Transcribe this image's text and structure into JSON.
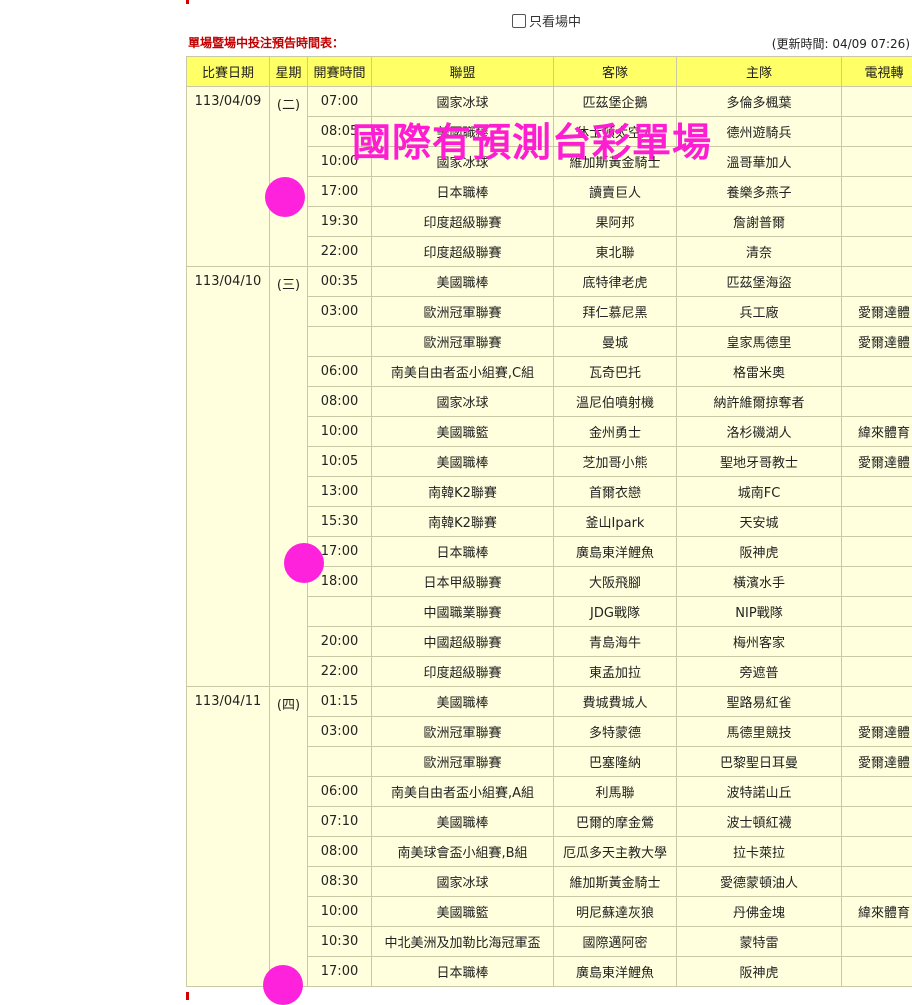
{
  "filter": {
    "label": "只看場中",
    "checked": false
  },
  "header": {
    "title": "單場暨場中投注預告時間表：",
    "updated": "(更新時間: 04/09 07:26)"
  },
  "table": {
    "columns": [
      "比賽日期",
      "星期",
      "開賽時間",
      "聯盟",
      "客隊",
      "主隊",
      "電視轉"
    ],
    "days": [
      {
        "date": "113/04/09",
        "weekday": "(二)",
        "rows": [
          {
            "time": "07:00",
            "league": "國家冰球",
            "away": "匹茲堡企鵝",
            "home": "多倫多楓葉",
            "tv": ""
          },
          {
            "time": "08:05",
            "league": "美國職棒",
            "away": "休士頓太空人",
            "home": "德州遊騎兵",
            "tv": ""
          },
          {
            "time": "10:00",
            "league": "國家冰球",
            "away": "維加斯黃金騎士",
            "home": "溫哥華加人",
            "tv": ""
          },
          {
            "time": "17:00",
            "league": "日本職棒",
            "away": "讀賣巨人",
            "home": "養樂多燕子",
            "tv": ""
          },
          {
            "time": "19:30",
            "league": "印度超級聯賽",
            "away": "果阿邦",
            "home": "詹謝普爾",
            "tv": ""
          },
          {
            "time": "22:00",
            "league": "印度超級聯賽",
            "away": "東北聯",
            "home": "清奈",
            "tv": ""
          }
        ]
      },
      {
        "date": "113/04/10",
        "weekday": "(三)",
        "rows": [
          {
            "time": "00:35",
            "league": "美國職棒",
            "away": "底特律老虎",
            "home": "匹茲堡海盜",
            "tv": ""
          },
          {
            "time": "03:00",
            "league": "歐洲冠軍聯賽",
            "away": "拜仁慕尼黑",
            "home": "兵工廠",
            "tv": "愛爾達體"
          },
          {
            "time": "",
            "league": "歐洲冠軍聯賽",
            "away": "曼城",
            "home": "皇家馬德里",
            "tv": "愛爾達體"
          },
          {
            "time": "06:00",
            "league": "南美自由者盃小組賽,C組",
            "away": "瓦奇巴托",
            "home": "格雷米奧",
            "tv": ""
          },
          {
            "time": "08:00",
            "league": "國家冰球",
            "away": "溫尼伯噴射機",
            "home": "納許維爾掠奪者",
            "tv": ""
          },
          {
            "time": "10:00",
            "league": "美國職籃",
            "away": "金州勇士",
            "home": "洛杉磯湖人",
            "tv": "緯來體育"
          },
          {
            "time": "10:05",
            "league": "美國職棒",
            "away": "芝加哥小熊",
            "home": "聖地牙哥教士",
            "tv": "愛爾達體"
          },
          {
            "time": "13:00",
            "league": "南韓K2聯賽",
            "away": "首爾衣戀",
            "home": "城南FC",
            "tv": ""
          },
          {
            "time": "15:30",
            "league": "南韓K2聯賽",
            "away": "釜山Ipark",
            "home": "天安城",
            "tv": ""
          },
          {
            "time": "17:00",
            "league": "日本職棒",
            "away": "廣島東洋鯉魚",
            "home": "阪神虎",
            "tv": ""
          },
          {
            "time": "18:00",
            "league": "日本甲級聯賽",
            "away": "大阪飛腳",
            "home": "橫濱水手",
            "tv": ""
          },
          {
            "time": "",
            "league": "中國職業聯賽",
            "away": "JDG戰隊",
            "home": "NIP戰隊",
            "tv": ""
          },
          {
            "time": "20:00",
            "league": "中國超級聯賽",
            "away": "青島海牛",
            "home": "梅州客家",
            "tv": ""
          },
          {
            "time": "22:00",
            "league": "印度超級聯賽",
            "away": "東孟加拉",
            "home": "旁遮普",
            "tv": ""
          }
        ]
      },
      {
        "date": "113/04/11",
        "weekday": "(四)",
        "rows": [
          {
            "time": "01:15",
            "league": "美國職棒",
            "away": "費城費城人",
            "home": "聖路易紅雀",
            "tv": ""
          },
          {
            "time": "03:00",
            "league": "歐洲冠軍聯賽",
            "away": "多特蒙德",
            "home": "馬德里競技",
            "tv": "愛爾達體"
          },
          {
            "time": "",
            "league": "歐洲冠軍聯賽",
            "away": "巴塞隆納",
            "home": "巴黎聖日耳曼",
            "tv": "愛爾達體"
          },
          {
            "time": "06:00",
            "league": "南美自由者盃小組賽,A組",
            "away": "利馬聯",
            "home": "波特諾山丘",
            "tv": ""
          },
          {
            "time": "07:10",
            "league": "美國職棒",
            "away": "巴爾的摩金鶯",
            "home": "波士頓紅襪",
            "tv": ""
          },
          {
            "time": "08:00",
            "league": "南美球會盃小組賽,B組",
            "away": "厄瓜多天主教大學",
            "home": "拉卡萊拉",
            "tv": ""
          },
          {
            "time": "08:30",
            "league": "國家冰球",
            "away": "維加斯黃金騎士",
            "home": "愛德蒙頓油人",
            "tv": ""
          },
          {
            "time": "10:00",
            "league": "美國職籃",
            "away": "明尼蘇達灰狼",
            "home": "丹佛金塊",
            "tv": "緯來體育"
          },
          {
            "time": "10:30",
            "league": "中北美洲及加勒比海冠軍盃",
            "away": "國際邁阿密",
            "home": "蒙特雷",
            "tv": ""
          },
          {
            "time": "17:00",
            "league": "日本職棒",
            "away": "廣島東洋鯉魚",
            "home": "阪神虎",
            "tv": ""
          }
        ]
      }
    ]
  },
  "overlay": {
    "watermark": "國際有預測台彩單場"
  },
  "colors": {
    "header_bg": "#ffff66",
    "cell_bg": "#ffffdd",
    "title_red": "#c00000",
    "watermark": "#ff1dd3"
  }
}
